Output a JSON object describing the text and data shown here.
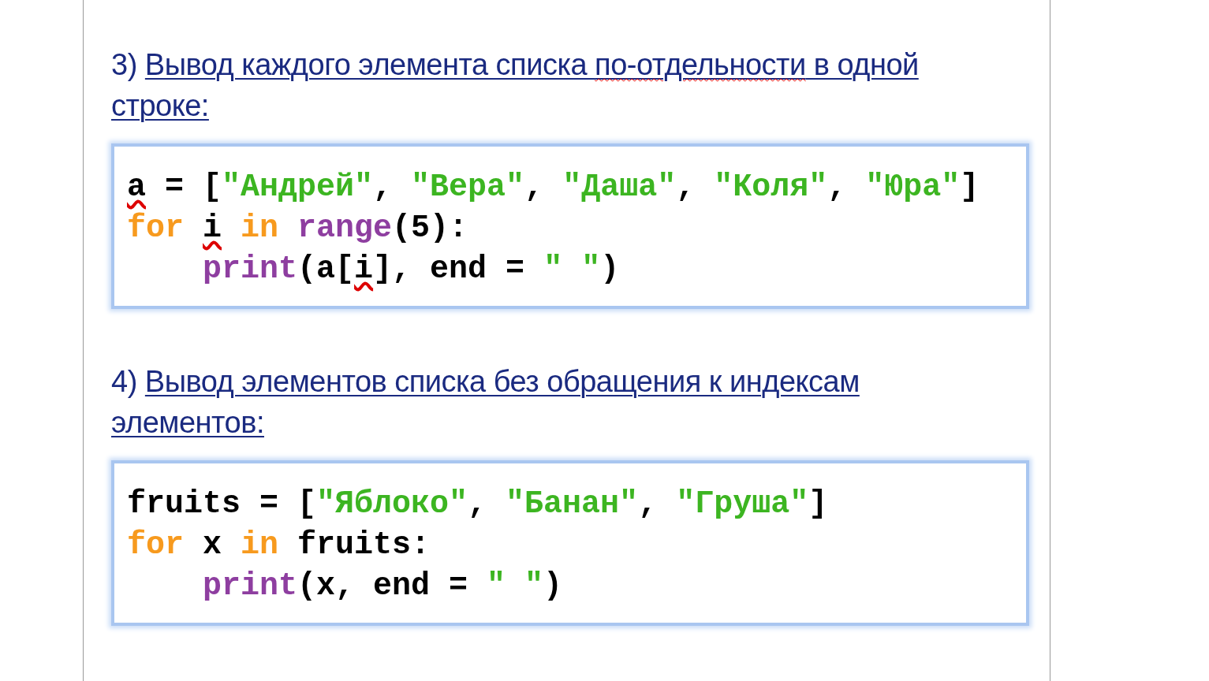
{
  "sections": [
    {
      "number": "3)",
      "title": [
        {
          "text": "Вывод каждого элемента списка "
        },
        {
          "text": "по-отдельности",
          "misspelled": true
        },
        {
          "text": " в одной строке:"
        }
      ],
      "code": [
        {
          "indented": false,
          "tokens": [
            {
              "text": "a",
              "kind": "plain",
              "misspelled": true
            },
            {
              "text": " = [",
              "kind": "plain"
            },
            {
              "text": "\"Андрей\"",
              "kind": "string"
            },
            {
              "text": ", ",
              "kind": "plain"
            },
            {
              "text": "\"Вера\"",
              "kind": "string"
            },
            {
              "text": ", ",
              "kind": "plain"
            },
            {
              "text": "\"Даша\"",
              "kind": "string"
            },
            {
              "text": ", ",
              "kind": "plain"
            },
            {
              "text": "\"Коля\"",
              "kind": "string"
            },
            {
              "text": ", ",
              "kind": "plain"
            },
            {
              "text": "\"Юра\"",
              "kind": "string"
            },
            {
              "text": "]",
              "kind": "plain"
            }
          ]
        },
        {
          "indented": false,
          "tokens": [
            {
              "text": "for",
              "kind": "keyword"
            },
            {
              "text": "i",
              "kind": "plain",
              "misspelled": true,
              "space_before": true
            },
            {
              "text": "in",
              "kind": "keyword",
              "space_before": true
            },
            {
              "text": "range",
              "kind": "builtin",
              "space_before": true
            },
            {
              "text": "(5):",
              "kind": "plain"
            }
          ]
        },
        {
          "indented": true,
          "tokens": [
            {
              "text": "print",
              "kind": "builtin"
            },
            {
              "text": "(a[",
              "kind": "plain"
            },
            {
              "text": "i",
              "kind": "plain",
              "misspelled": true
            },
            {
              "text": "], end = ",
              "kind": "plain"
            },
            {
              "text": "\" \"",
              "kind": "string"
            },
            {
              "text": ")",
              "kind": "plain"
            }
          ]
        }
      ]
    },
    {
      "number": "4)",
      "title": [
        {
          "text": "Вывод элементов списка без обращения к индексам элементов:"
        }
      ],
      "code": [
        {
          "indented": false,
          "tokens": [
            {
              "text": "fruits = [",
              "kind": "plain"
            },
            {
              "text": "\"Яблоко\"",
              "kind": "string"
            },
            {
              "text": ", ",
              "kind": "plain"
            },
            {
              "text": "\"Банан\"",
              "kind": "string"
            },
            {
              "text": ", ",
              "kind": "plain"
            },
            {
              "text": "\"Груша\"",
              "kind": "string"
            },
            {
              "text": "]",
              "kind": "plain"
            }
          ]
        },
        {
          "indented": false,
          "tokens": [
            {
              "text": "for",
              "kind": "keyword"
            },
            {
              "text": " x ",
              "kind": "plain"
            },
            {
              "text": "in",
              "kind": "keyword"
            },
            {
              "text": " fruits:",
              "kind": "plain"
            }
          ]
        },
        {
          "indented": true,
          "tokens": [
            {
              "text": "print",
              "kind": "builtin"
            },
            {
              "text": "(x, end = ",
              "kind": "plain"
            },
            {
              "text": "\" \"",
              "kind": "string"
            },
            {
              "text": ")",
              "kind": "plain"
            }
          ]
        }
      ]
    }
  ]
}
